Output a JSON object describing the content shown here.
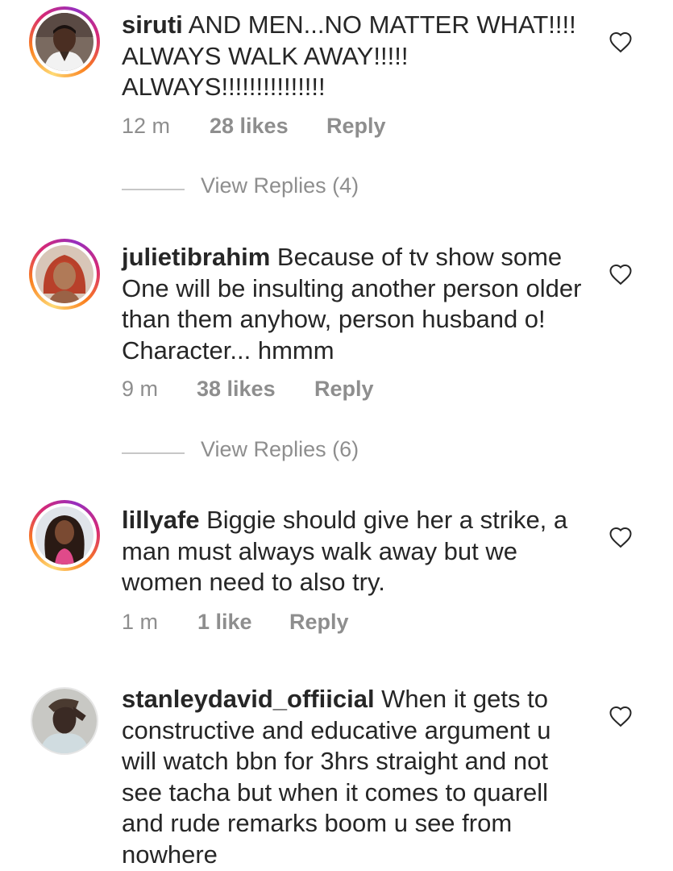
{
  "comments": [
    {
      "username": "siruti",
      "text": " AND MEN...NO MATTER WHAT!!!! ALWAYS WALK AWAY!!!!! ALWAYS!!!!!!!!!!!!!!!",
      "time": "12 m",
      "likes": "28 likes",
      "reply": "Reply",
      "view_replies": "View Replies (4)",
      "avatar_icon": "profile-photo-man-white-outfit"
    },
    {
      "username": "julietibrahim",
      "text": " Because of tv show some One will be insulting another person older than them anyhow, person husband o! Character... hmmm",
      "time": "9 m",
      "likes": "38 likes",
      "reply": "Reply",
      "view_replies": "View Replies (6)",
      "avatar_icon": "profile-photo-woman-red-hair"
    },
    {
      "username": "lillyafe",
      "text": " Biggie should give her a strike, a man must always walk away but we women need to also try.",
      "time": "1 m",
      "likes": "1 like",
      "reply": "Reply",
      "avatar_icon": "profile-photo-woman-long-hair"
    },
    {
      "username": "stanleydavid_offiicial",
      "text": " When it gets to constructive and educative argument u will watch bbn for 3hrs straight and not see tacha but when it comes to quarell and rude remarks boom u see from nowhere",
      "avatar_icon": "profile-photo-man-hand-on-head"
    }
  ],
  "colors": {
    "text": "#262626",
    "muted": "#8e8e8e",
    "story_ring": [
      "#feda75",
      "#fa7e1e",
      "#d62976",
      "#962fbf"
    ]
  },
  "icons": {
    "like": "heart-outline-icon"
  }
}
